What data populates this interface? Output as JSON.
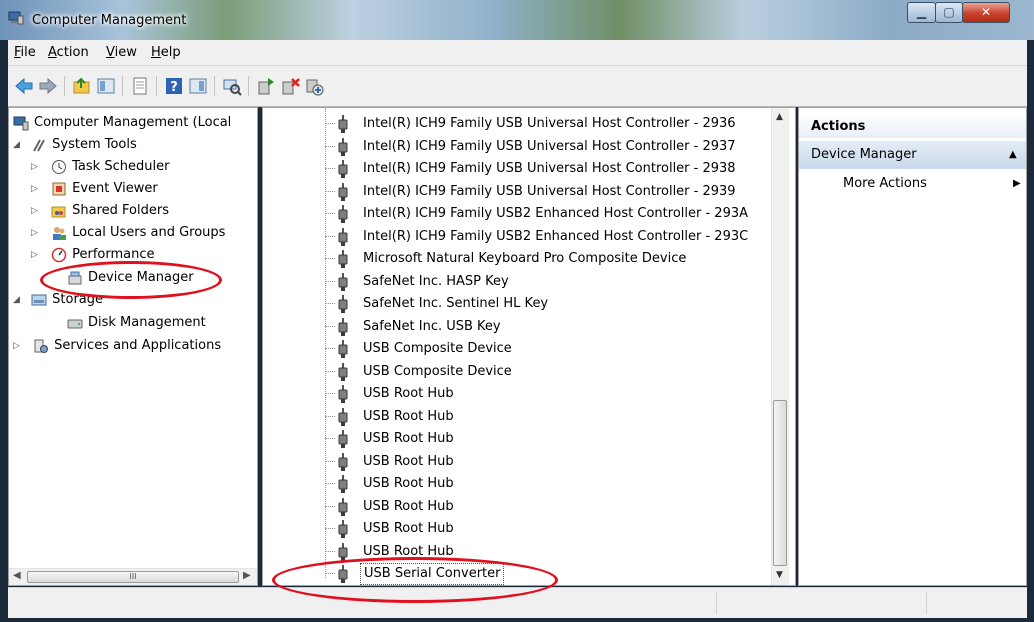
{
  "window": {
    "title": "Computer Management"
  },
  "menu": [
    {
      "label": "File",
      "accel": "F",
      "rest": "ile"
    },
    {
      "label": "Action",
      "accel": "A",
      "rest": "ction"
    },
    {
      "label": "View",
      "accel": "V",
      "rest": "iew"
    },
    {
      "label": "Help",
      "accel": "H",
      "rest": "elp"
    }
  ],
  "toolbar": [
    "back-icon",
    "forward-icon",
    "up-folder-icon",
    "console-tree-icon",
    "properties-icon",
    "help-icon",
    "action-pane-icon",
    "scan-hardware-icon",
    "update-driver-icon",
    "uninstall-icon",
    "disable-icon"
  ],
  "tree": {
    "root": "Computer Management (Local",
    "system_tools": "System Tools",
    "task_scheduler": "Task Scheduler",
    "event_viewer": "Event Viewer",
    "shared_folders": "Shared Folders",
    "local_users": "Local Users and Groups",
    "performance": "Performance",
    "device_manager": "Device Manager",
    "storage": "Storage",
    "disk_management": "Disk Management",
    "services": "Services and Applications"
  },
  "devices": [
    "Intel(R) ICH9 Family USB Universal Host Controller - 2936",
    "Intel(R) ICH9 Family USB Universal Host Controller - 2937",
    "Intel(R) ICH9 Family USB Universal Host Controller - 2938",
    "Intel(R) ICH9 Family USB Universal Host Controller - 2939",
    "Intel(R) ICH9 Family USB2 Enhanced Host Controller - 293A",
    "Intel(R) ICH9 Family USB2 Enhanced Host Controller - 293C",
    "Microsoft Natural Keyboard Pro Composite Device",
    "SafeNet Inc. HASP Key",
    "SafeNet Inc. Sentinel HL Key",
    "SafeNet Inc. USB Key",
    "USB Composite Device",
    "USB Composite Device",
    "USB Root Hub",
    "USB Root Hub",
    "USB Root Hub",
    "USB Root Hub",
    "USB Root Hub",
    "USB Root Hub",
    "USB Root Hub",
    "USB Root Hub",
    "USB Serial Converter"
  ],
  "actions": {
    "header": "Actions",
    "section": "Device Manager",
    "more": "More Actions"
  },
  "colors": {
    "highlight_ellipse": "#e0101e"
  }
}
